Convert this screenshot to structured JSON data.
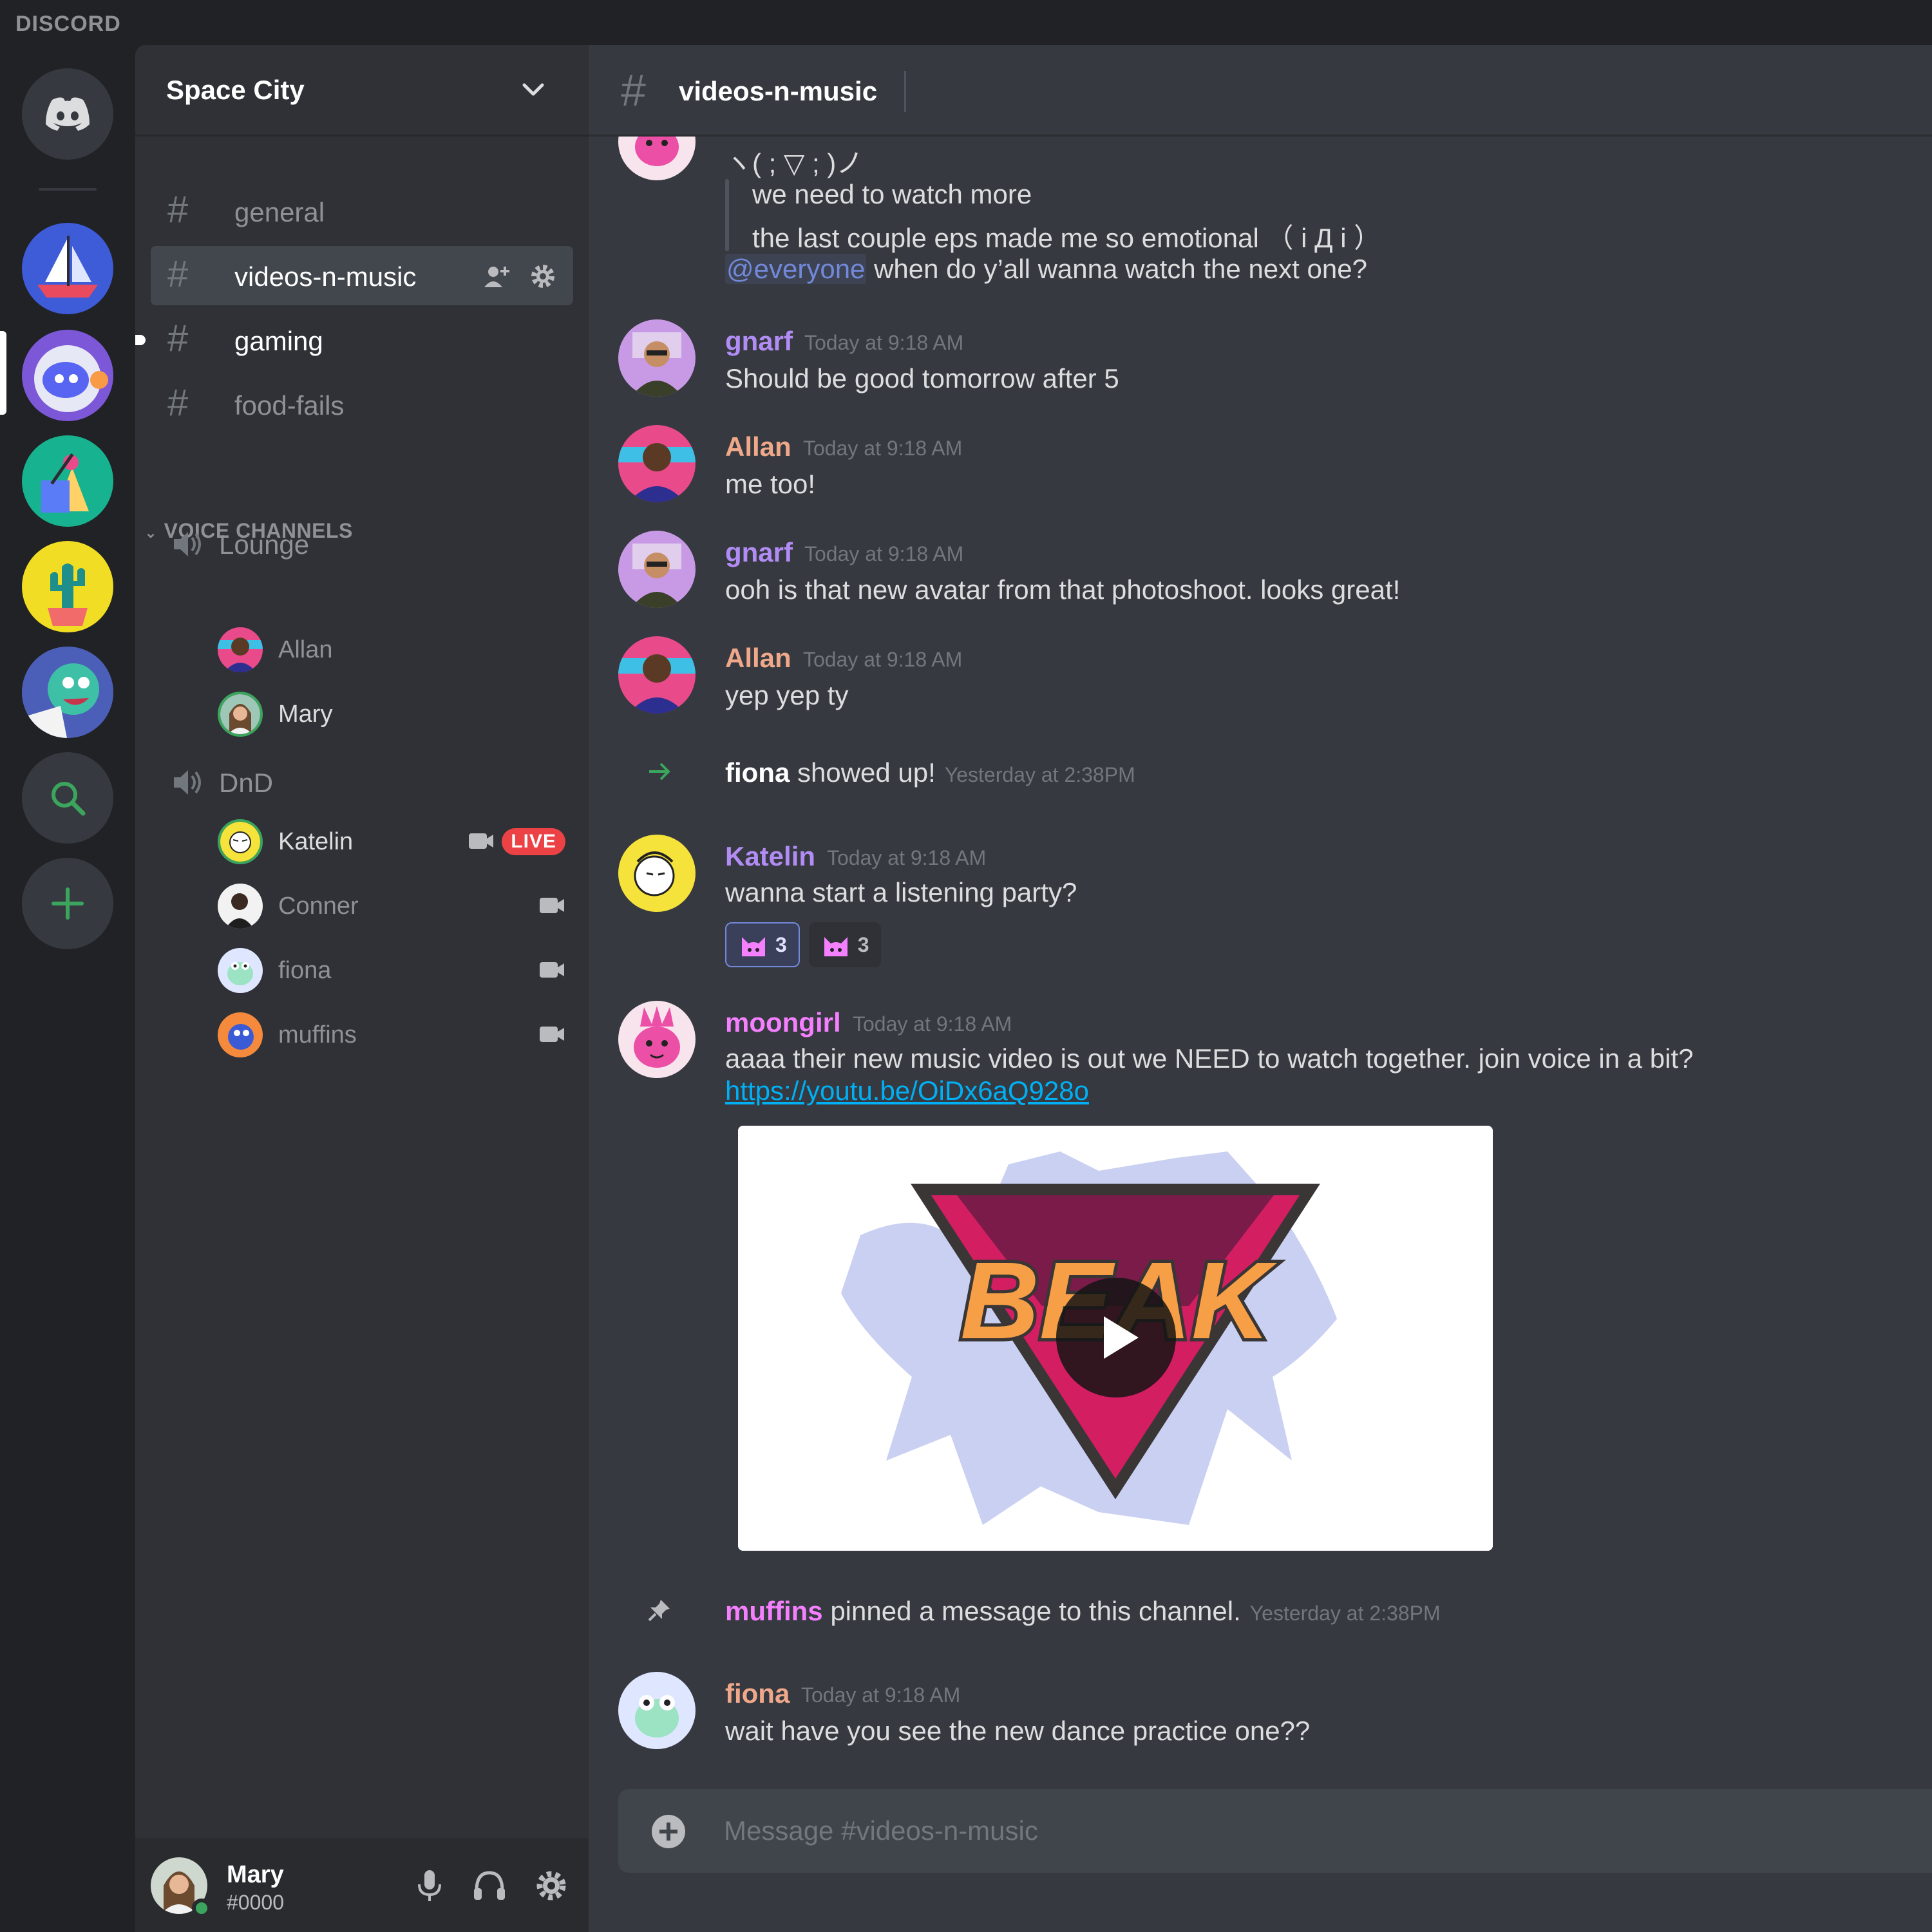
{
  "app": {
    "brand": "DISCORD"
  },
  "colors": {
    "accent": "#7289da",
    "online": "#3ba55d",
    "live": "#ed4245",
    "link": "#00b0f4"
  },
  "server": {
    "name": "Space City"
  },
  "channels": [
    {
      "name": "general",
      "icon": "hash-icon"
    },
    {
      "name": "videos-n-music",
      "icon": "hash-icon",
      "active": true
    },
    {
      "name": "gaming",
      "icon": "hash-icon",
      "unread": true
    },
    {
      "name": "food-fails",
      "icon": "hash-icon"
    }
  ],
  "voice": {
    "category": "VOICE CHANNELS",
    "channels": [
      {
        "name": "Lounge",
        "users": [
          "Allan",
          "Mary"
        ]
      },
      {
        "name": "DnD",
        "users": [
          {
            "name": "Katelin",
            "camera": true,
            "live": "LIVE"
          },
          {
            "name": "Conner",
            "camera": true
          },
          {
            "name": "fiona",
            "camera": true
          },
          {
            "name": "muffins",
            "camera": true
          }
        ]
      }
    ]
  },
  "user": {
    "name": "Mary",
    "tag": "#0000"
  },
  "chat": {
    "channel": "videos-n-music",
    "messages": [
      {
        "lines": [
          "ヽ( ; ▽ ; )ノ",
          "we need to watch more",
          "the last couple eps made me so emotional （ i Д i ）"
        ],
        "mention": "@everyone",
        "mention_rest": " when do y’all wanna watch the next one?"
      },
      {
        "author": "gnarf",
        "color": "#b28cf5",
        "time": "Today at 9:18 AM",
        "text": "Should be good tomorrow after 5"
      },
      {
        "author": "Allan",
        "color": "#f0a88b",
        "time": "Today at 9:18 AM",
        "text": "me too!"
      },
      {
        "author": "gnarf",
        "color": "#b28cf5",
        "time": "Today at 9:18 AM",
        "text": "ooh is that new avatar from that photoshoot. looks great!"
      },
      {
        "author": "Allan",
        "color": "#f0a88b",
        "time": "Today at 9:18 AM",
        "text": "yep yep ty"
      },
      {
        "system": "join",
        "name": "fiona",
        "text": " showed up!",
        "time": "Yesterday at 2:38PM"
      },
      {
        "author": "Katelin",
        "color": "#b28cf5",
        "time": "Today at 9:18 AM",
        "text": "wanna start a listening party?",
        "reactions": [
          {
            "icon": "cat-emoji-icon",
            "count": "3"
          },
          {
            "icon": "cat-emoji-icon",
            "count": "3"
          }
        ]
      },
      {
        "author": "moongirl",
        "color": "#f47fff",
        "time": "Today at 9:18 AM",
        "text": "aaaa their new music video is out we NEED to watch together. join voice in a bit?",
        "link": "https://youtu.be/OiDx6aQ928o",
        "embed_title": "BEAK"
      },
      {
        "system": "pin",
        "name": "muffins",
        "text": " pinned a message to this channel.",
        "time": "Yesterday at 2:38PM"
      },
      {
        "author": "fiona",
        "color": "#f0a88b",
        "time": "Today at 9:18 AM",
        "text": "wait have you see the new dance practice one??"
      }
    ],
    "composer_placeholder": "Message #videos-n-music"
  }
}
